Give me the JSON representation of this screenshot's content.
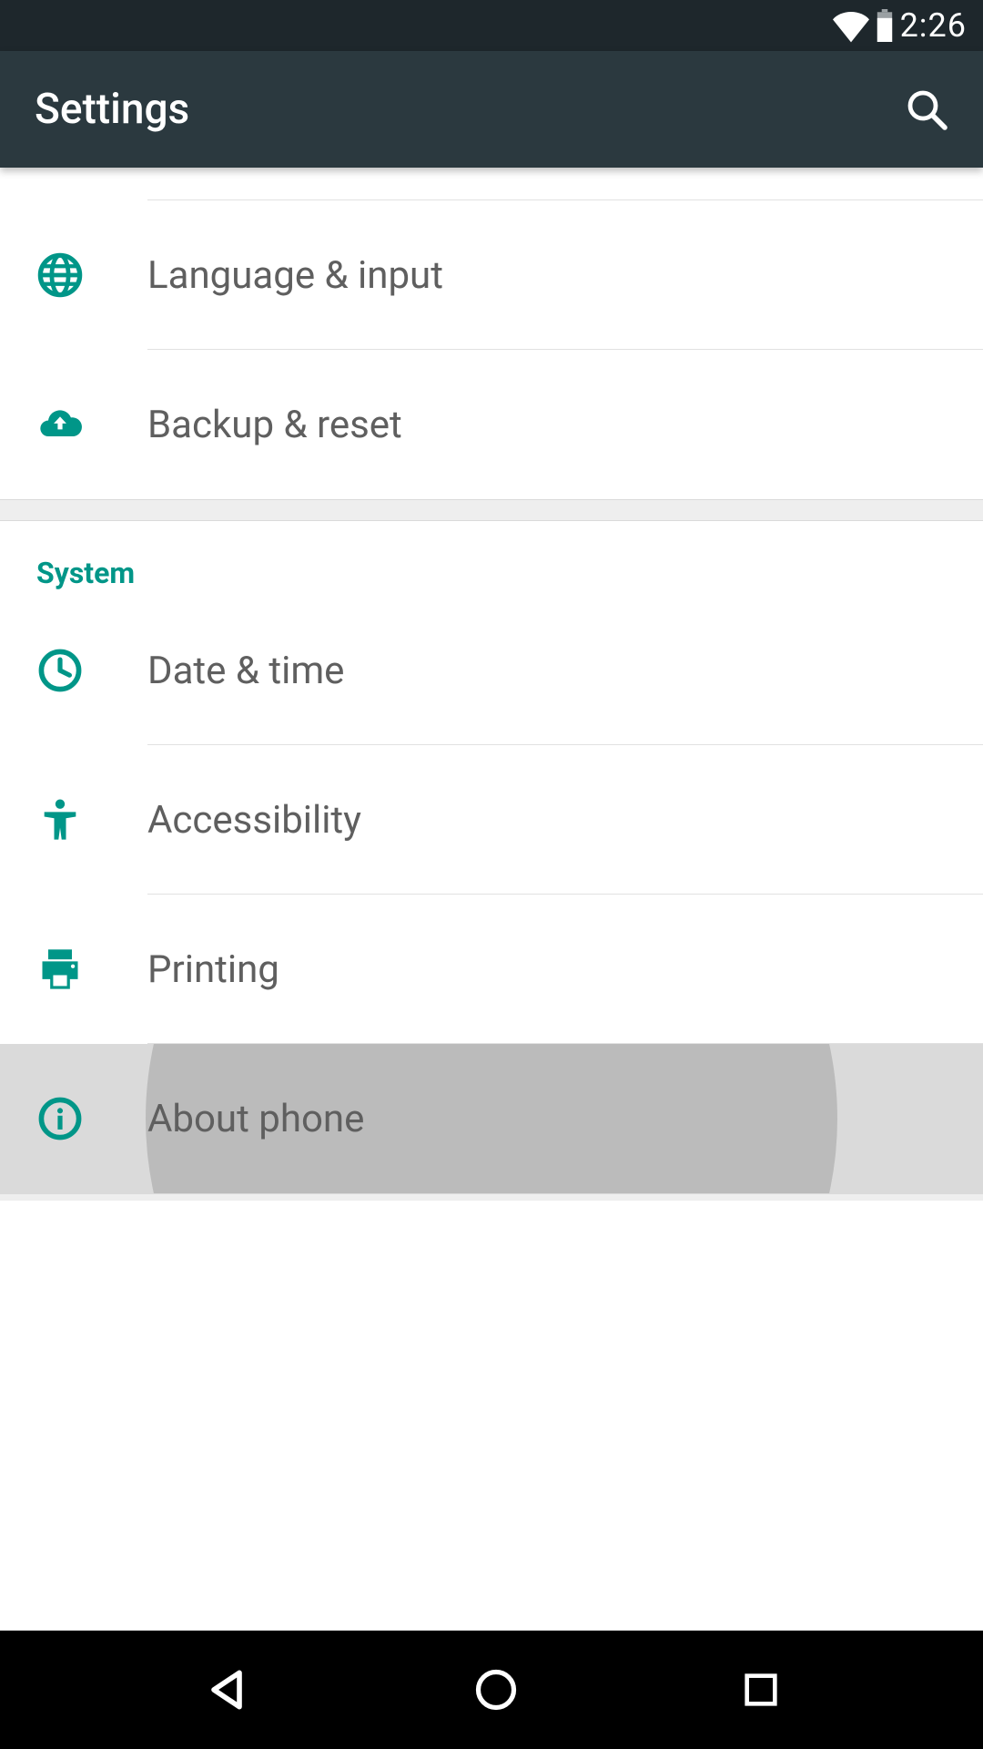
{
  "status": {
    "time": "2:26"
  },
  "appbar": {
    "title": "Settings"
  },
  "colors": {
    "accent": "#009688",
    "appbar_bg": "#2b393f",
    "statusbar_bg": "#1e272c",
    "item_text": "#5f5f5f"
  },
  "items_top": [
    {
      "icon": "globe-icon",
      "label": "Language & input"
    },
    {
      "icon": "cloud-upload-icon",
      "label": "Backup & reset"
    }
  ],
  "section": {
    "header": "System",
    "items": [
      {
        "icon": "clock-icon",
        "label": "Date & time"
      },
      {
        "icon": "accessibility-icon",
        "label": "Accessibility"
      },
      {
        "icon": "printer-icon",
        "label": "Printing"
      },
      {
        "icon": "info-icon",
        "label": "About phone",
        "pressed": true
      }
    ]
  }
}
